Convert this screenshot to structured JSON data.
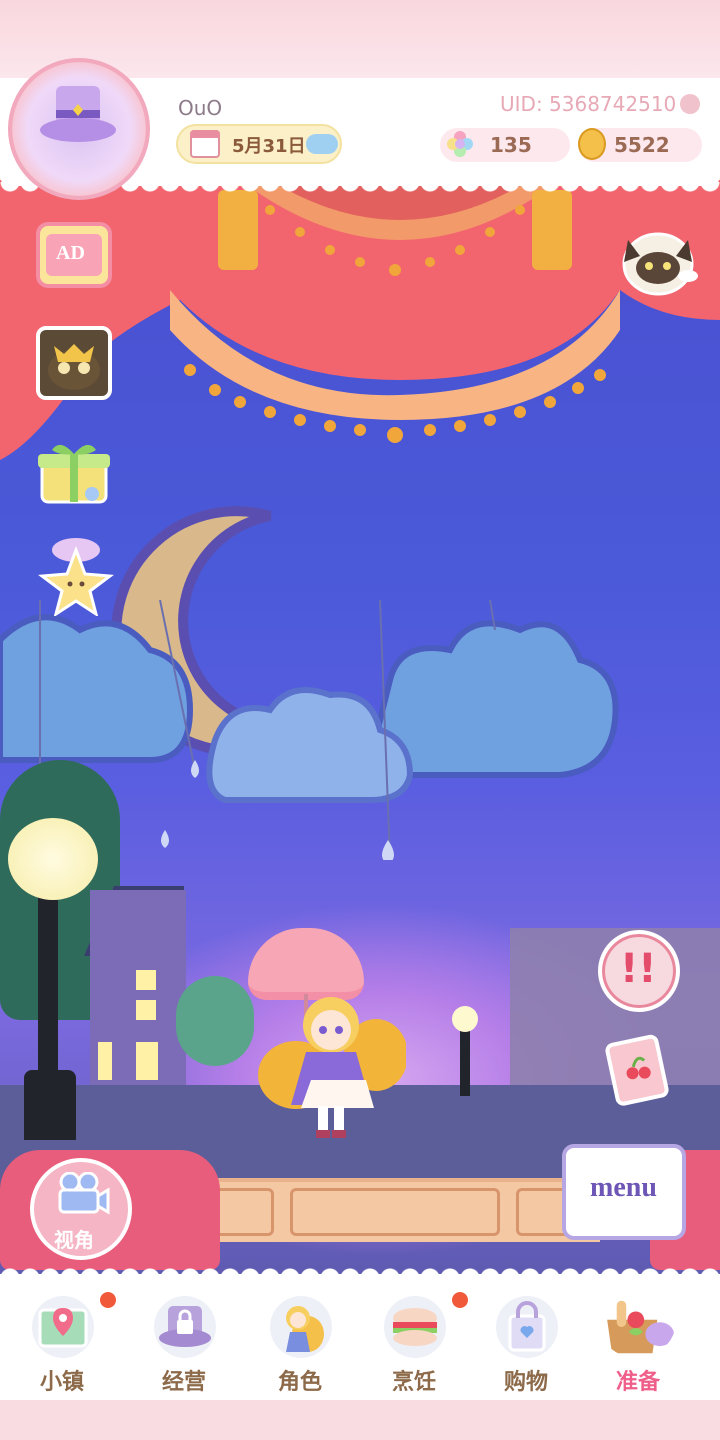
{
  "header": {
    "player_name": "OuO",
    "uid": "UID: 5368742510",
    "date": "5月31日",
    "gems": "135",
    "coins": "5522"
  },
  "side_buttons": {
    "ad_label": "AD"
  },
  "right_buttons": {
    "alert_glyph": "!!",
    "menu_label": "menu"
  },
  "camera": {
    "label": "视角"
  },
  "bottom_nav": [
    {
      "label": "小镇",
      "badge": true
    },
    {
      "label": "经营",
      "badge": false
    },
    {
      "label": "角色",
      "badge": false
    },
    {
      "label": "烹饪",
      "badge": true
    },
    {
      "label": "购物",
      "badge": false
    },
    {
      "label": "准备",
      "badge": false,
      "active": true
    }
  ],
  "colors": {
    "accent_pink": "#ef5f8a",
    "curtain_red": "#f2656e",
    "stage_blue": "#4a4fd0"
  }
}
